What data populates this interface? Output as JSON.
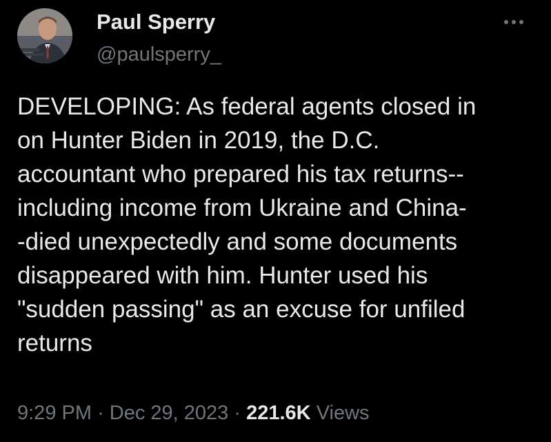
{
  "author": {
    "display_name": "Paul Sperry",
    "handle": "@paulsperry_",
    "avatar_icon": "profile-photo"
  },
  "more_icon": "ellipsis-icon",
  "tweet": {
    "lines": [
      "DEVELOPING: As federal agents closed in",
      "on Hunter Biden in 2019, the D.C.",
      "accountant who prepared his tax returns--",
      "including income from Ukraine and China-",
      "-died unexpectedly and some documents",
      "disappeared with him. Hunter used his",
      "\"sudden passing\" as an excuse for unfiled",
      "returns"
    ]
  },
  "meta": {
    "time": "9:29 PM",
    "separator": "·",
    "date": "Dec 29, 2023",
    "views_count": "221.6K",
    "views_label": "Views"
  },
  "colors": {
    "background": "#000000",
    "primary_text": "#e7e9ea",
    "secondary_text": "#71767b"
  }
}
